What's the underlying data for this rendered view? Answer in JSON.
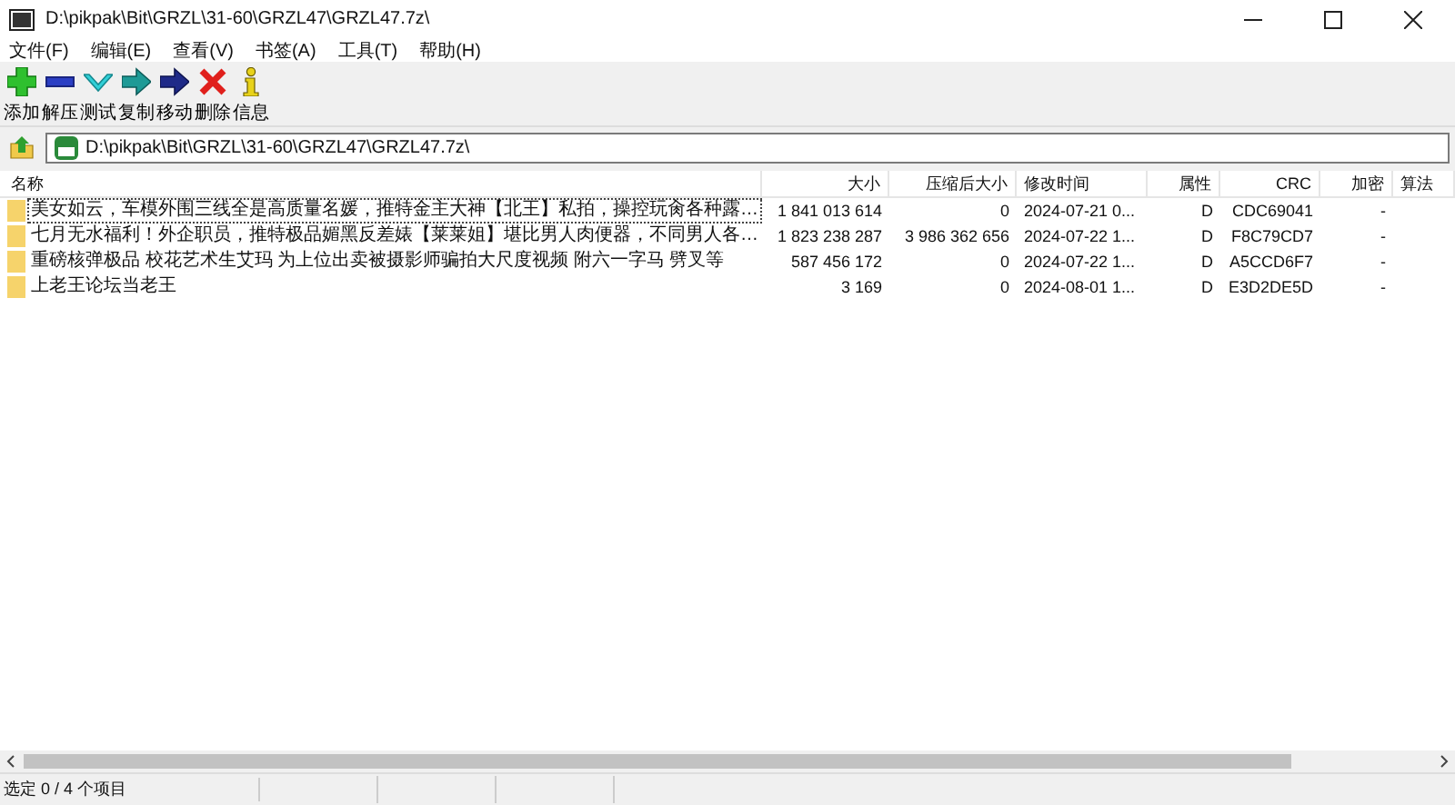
{
  "window": {
    "title": "D:\\pikpak\\Bit\\GRZL\\31-60\\GRZL47\\GRZL47.7z\\"
  },
  "menu": [
    "文件(F)",
    "编辑(E)",
    "查看(V)",
    "书签(A)",
    "工具(T)",
    "帮助(H)"
  ],
  "toolbar": [
    {
      "kind": "add",
      "label": "添加"
    },
    {
      "kind": "extract",
      "label": "解压"
    },
    {
      "kind": "test",
      "label": "测试"
    },
    {
      "kind": "copy",
      "label": "复制"
    },
    {
      "kind": "move",
      "label": "移动"
    },
    {
      "kind": "delete",
      "label": "删除"
    },
    {
      "kind": "info",
      "label": "信息"
    }
  ],
  "address": {
    "value": "D:\\pikpak\\Bit\\GRZL\\31-60\\GRZL47\\GRZL47.7z\\"
  },
  "table": {
    "columns": [
      "名称",
      "大小",
      "压缩后大小",
      "修改时间",
      "属性",
      "CRC",
      "加密",
      "算法"
    ],
    "rows": [
      {
        "focused": true,
        "cells": [
          "美女如云，车模外围三线全是高质量名媛，推特金主大神【北王】私拍，操控玩肏各种露…",
          "1 841 013 614",
          "0",
          "2024-07-21 0...",
          "D",
          "CDC69041",
          "-"
        ]
      },
      {
        "focused": false,
        "cells": [
          "七月无水福利！外企职员，推特极品媚黑反差婊【莱莱姐】堪比男人肉便器，不同男人各…",
          "1 823 238 287",
          "3 986 362 656",
          "2024-07-22 1...",
          "D",
          "F8C79CD7",
          "-"
        ]
      },
      {
        "focused": false,
        "cells": [
          "重磅核弹极品 校花艺术生艾玛 为上位出卖被摄影师骗拍大尺度视频 附六一字马 劈叉等",
          "587 456 172",
          "0",
          "2024-07-22 1...",
          "D",
          "A5CCD6F7",
          "-"
        ]
      },
      {
        "focused": false,
        "cells": [
          "上老王论坛当老王",
          "3 169",
          "0",
          "2024-08-01 1...",
          "D",
          "E3D2DE5D",
          "-"
        ]
      }
    ]
  },
  "status_bar": [
    "选定 0 / 4 个项目"
  ]
}
